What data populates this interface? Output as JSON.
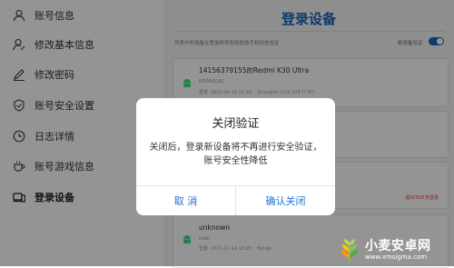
{
  "sidebar": {
    "items": [
      {
        "label": "账号信息",
        "icon": "user-icon"
      },
      {
        "label": "修改基本信息",
        "icon": "user-edit-icon"
      },
      {
        "label": "修改密码",
        "icon": "pencil-icon"
      },
      {
        "label": "账号安全设置",
        "icon": "shield-icon"
      },
      {
        "label": "日志详情",
        "icon": "clock-icon"
      },
      {
        "label": "账号游戏信息",
        "icon": "cup-icon"
      },
      {
        "label": "登录设备",
        "icon": "devices-icon",
        "active": true
      }
    ]
  },
  "main": {
    "title": "登录设备",
    "description": "列表中的设备在登录时将免除短信手机短信验证",
    "toggle_label": "新设备验证",
    "toggle_on": true,
    "devices": [
      {
        "name": "14156379155的Redmi K30 Ultra",
        "model": "M2006J10C",
        "login_label": "登录",
        "login_time": "2022-04-18 11:40",
        "location": "Shanghai (116.224.**.87)"
      },
      {
        "name": "unknown",
        "model": "iolan",
        "login_label": "登录",
        "login_time": "2021-11-14 10:25",
        "location": "Bangk"
      }
    ],
    "red_hint": "超出30天未登录"
  },
  "dialog": {
    "title": "关闭验证",
    "message": "关闭后，登录新设备将不再进行安全验证，账号安全性降低",
    "cancel_label": "取 消",
    "confirm_label": "确认关闭"
  },
  "watermark": {
    "name": "小麦安卓网",
    "url": "www.xmsigma.com"
  },
  "colors": {
    "accent": "#1565c0",
    "dialog_button": "#1a73d9",
    "android_green": "#3ddc84"
  }
}
